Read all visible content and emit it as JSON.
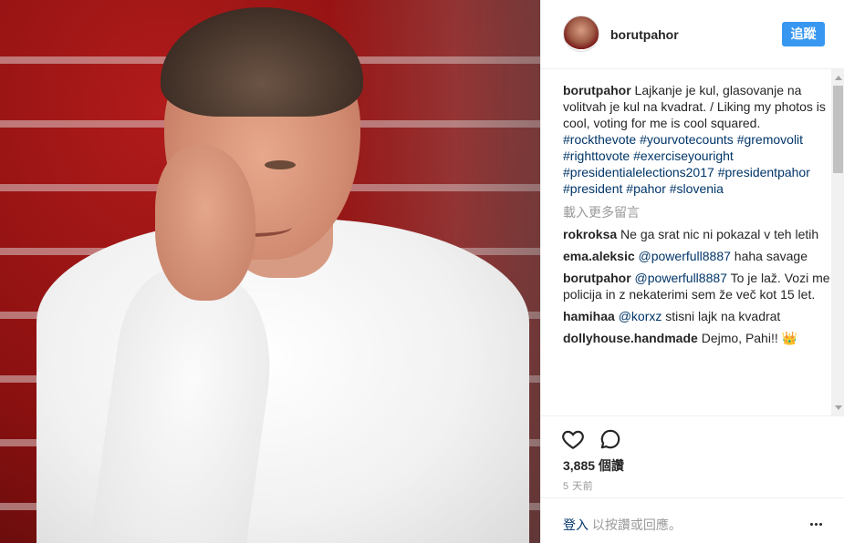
{
  "post": {
    "image_alt": "Portrait of a smiling man in a white shirt resting chin on hand, red staircase background",
    "author": "borutpahor",
    "follow_label": "追蹤"
  },
  "caption": {
    "user": "borutpahor",
    "text": "Lajkanje je kul, glasovanje na volitvah je kul na kvadrat. / Liking my photos is cool, voting for me is cool squared.",
    "hashtags": [
      "#rockthevote",
      "#yourvotecounts",
      "#gremovolit",
      "#righttovote",
      "#exerciseyouright",
      "#presidentialelections2017",
      "#presidentpahor",
      "#president",
      "#pahor",
      "#slovenia"
    ]
  },
  "load_more": "載入更多留言",
  "comments": [
    {
      "user": "rokroksa",
      "mention": "",
      "text": "Ne ga srat nic ni pokazal v teh letih"
    },
    {
      "user": "ema.aleksic",
      "mention": "@powerfull8887",
      "text": "haha savage"
    },
    {
      "user": "borutpahor",
      "mention": "@powerfull8887",
      "text": "To je laž. Vozi me policija in z nekaterimi sem že več kot 15 let."
    },
    {
      "user": "hamihaa",
      "mention": "@korxz",
      "text": "stisni lajk na kvadrat"
    },
    {
      "user": "dollyhouse.handmade",
      "mention": "",
      "text": "Dejmo, Pahi!! 👑"
    }
  ],
  "stats": {
    "likes": "3,885 個讚",
    "time": "5 天前"
  },
  "footer": {
    "login": "登入",
    "login_suffix": " 以按讚或回應。"
  },
  "icons": {
    "like": "heart-icon",
    "comment": "comment-icon",
    "more": "more-options-icon"
  }
}
